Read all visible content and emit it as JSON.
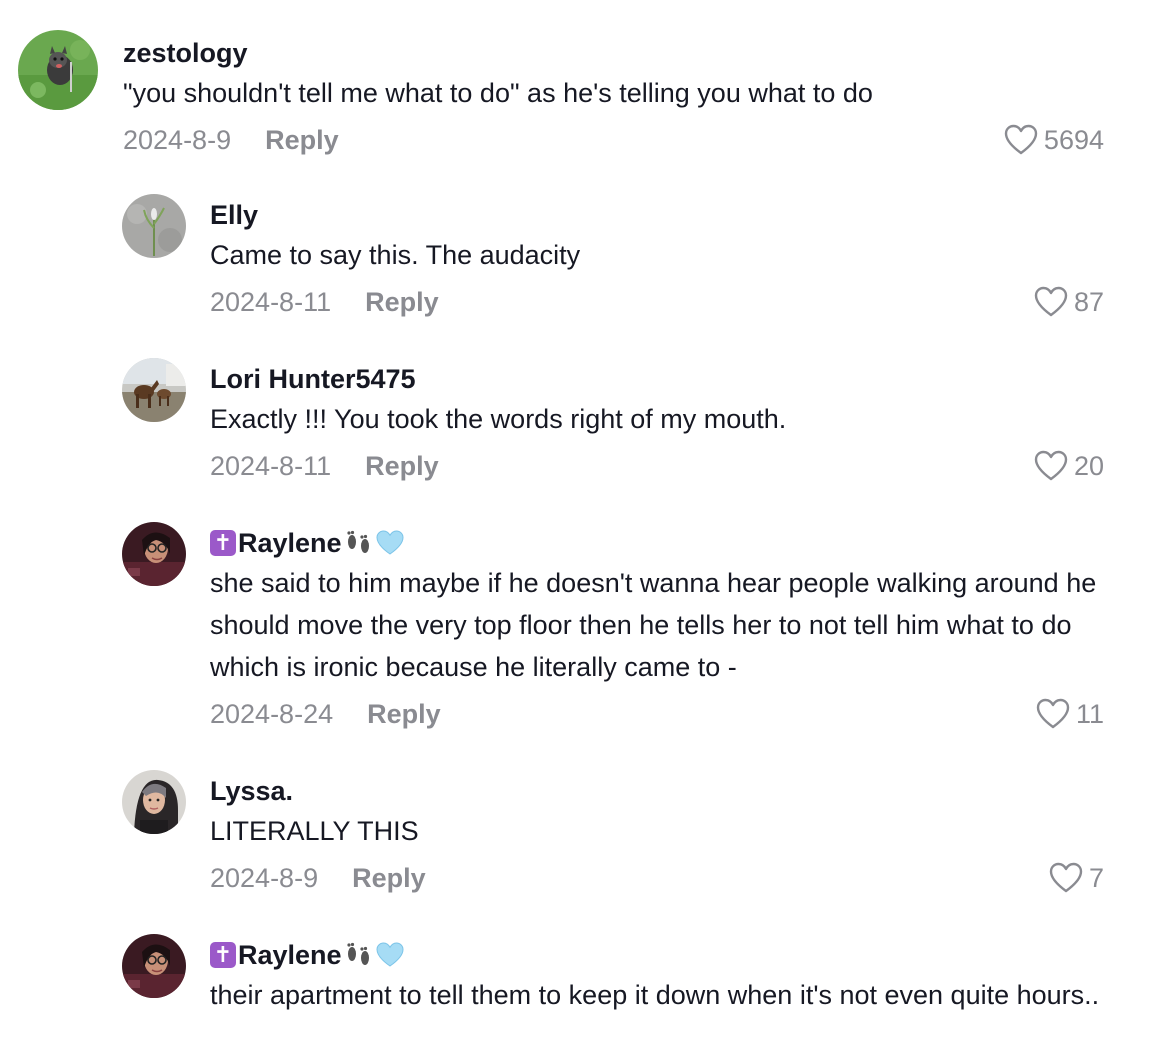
{
  "comments": [
    {
      "username": "zestology",
      "text": "\"you shouldn't tell me what to do\" as he's telling you what to do",
      "date": "2024-8-9",
      "reply_label": "Reply",
      "likes": "5694",
      "avatar": "dog-on-grass-avatar"
    },
    {
      "username": "Elly",
      "text": "Came to say this. The audacity",
      "date": "2024-8-11",
      "reply_label": "Reply",
      "likes": "87",
      "avatar": "plant-sprout-avatar"
    },
    {
      "username": "Lori Hunter5475",
      "text": "Exactly !!! You took the words right of my mouth.",
      "date": "2024-8-11",
      "reply_label": "Reply",
      "likes": "20",
      "avatar": "horses-avatar"
    },
    {
      "username": "Raylene",
      "text": "she said to him maybe if he doesn't wanna hear people walking around he should move the very top floor then he tells her to not tell him what to do which is ironic because he literally came to -",
      "date": "2024-8-24",
      "reply_label": "Reply",
      "likes": "11",
      "avatar": "woman-glasses-avatar",
      "name_prefix_icon": "latin-cross-icon",
      "name_suffix_icons": [
        "footprints-icon",
        "light-blue-heart-icon"
      ]
    },
    {
      "username": "Lyssa.",
      "text": "LITERALLY THIS",
      "date": "2024-8-9",
      "reply_label": "Reply",
      "likes": "7",
      "avatar": "woman-portrait-avatar"
    },
    {
      "username": "Raylene",
      "text": "their apartment to tell them to keep it down when it's not even quite hours..",
      "avatar": "woman-glasses-avatar",
      "name_prefix_icon": "latin-cross-icon",
      "name_suffix_icons": [
        "footprints-icon",
        "light-blue-heart-icon"
      ]
    }
  ],
  "colors": {
    "text_primary": "#161823",
    "text_secondary": "#8a8b91",
    "badge_purple": "#9b59c9",
    "heart_blue": "#a6dcf5"
  }
}
